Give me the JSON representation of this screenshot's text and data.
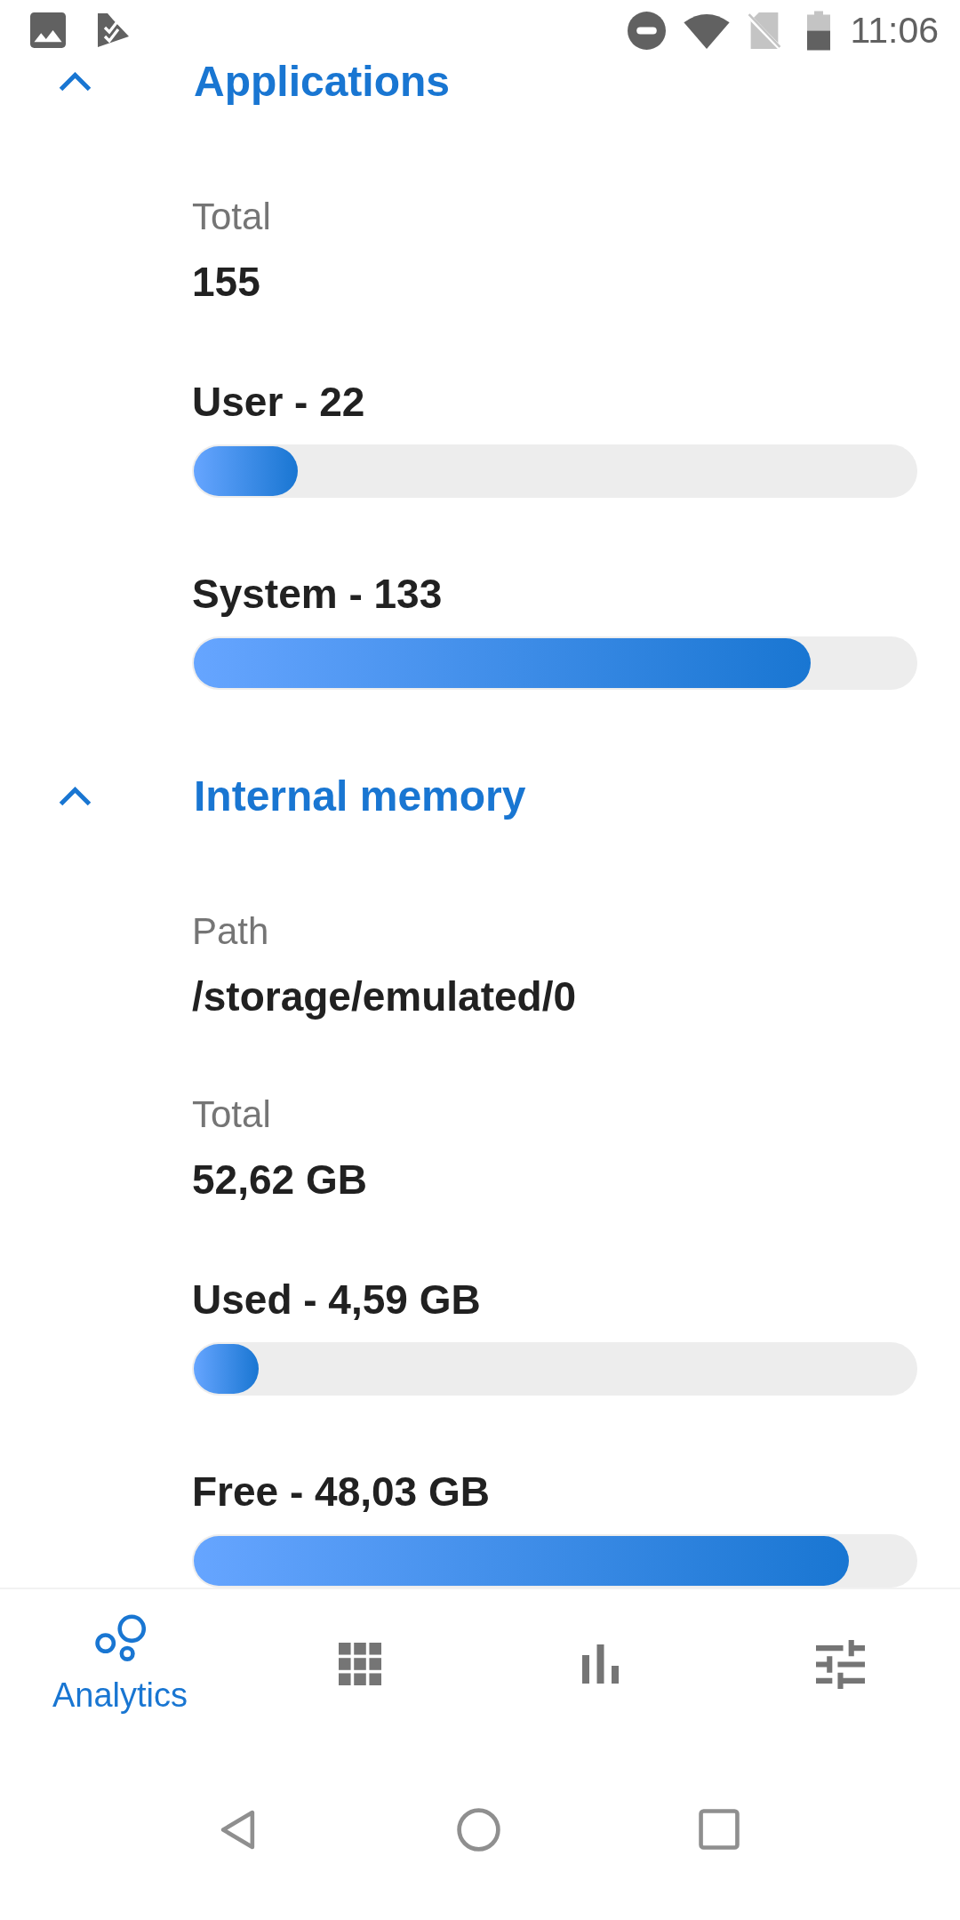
{
  "status_bar": {
    "time": "11:06"
  },
  "sections": [
    {
      "title": "Applications",
      "expanded": true,
      "fields": [
        {
          "kind": "info",
          "label": "Total",
          "value": "155"
        },
        {
          "kind": "bar",
          "label": "User - 22",
          "level": 0.144
        },
        {
          "kind": "bar",
          "label": "System - 133",
          "level": 0.855
        }
      ]
    },
    {
      "title": "Internal memory",
      "expanded": true,
      "fields": [
        {
          "kind": "info",
          "label": "Path",
          "value": "/storage/emulated/0"
        },
        {
          "kind": "info",
          "label": "Total",
          "value": "52,62 GB"
        },
        {
          "kind": "bar",
          "label": "Used - 4,59 GB",
          "level": 0.09
        },
        {
          "kind": "bar",
          "label": "Free - 48,03 GB",
          "level": 0.908
        }
      ]
    }
  ],
  "bottom_nav": [
    {
      "label": "Analytics",
      "selected": true
    },
    {
      "selected": false
    },
    {
      "selected": false
    },
    {
      "selected": false
    }
  ]
}
